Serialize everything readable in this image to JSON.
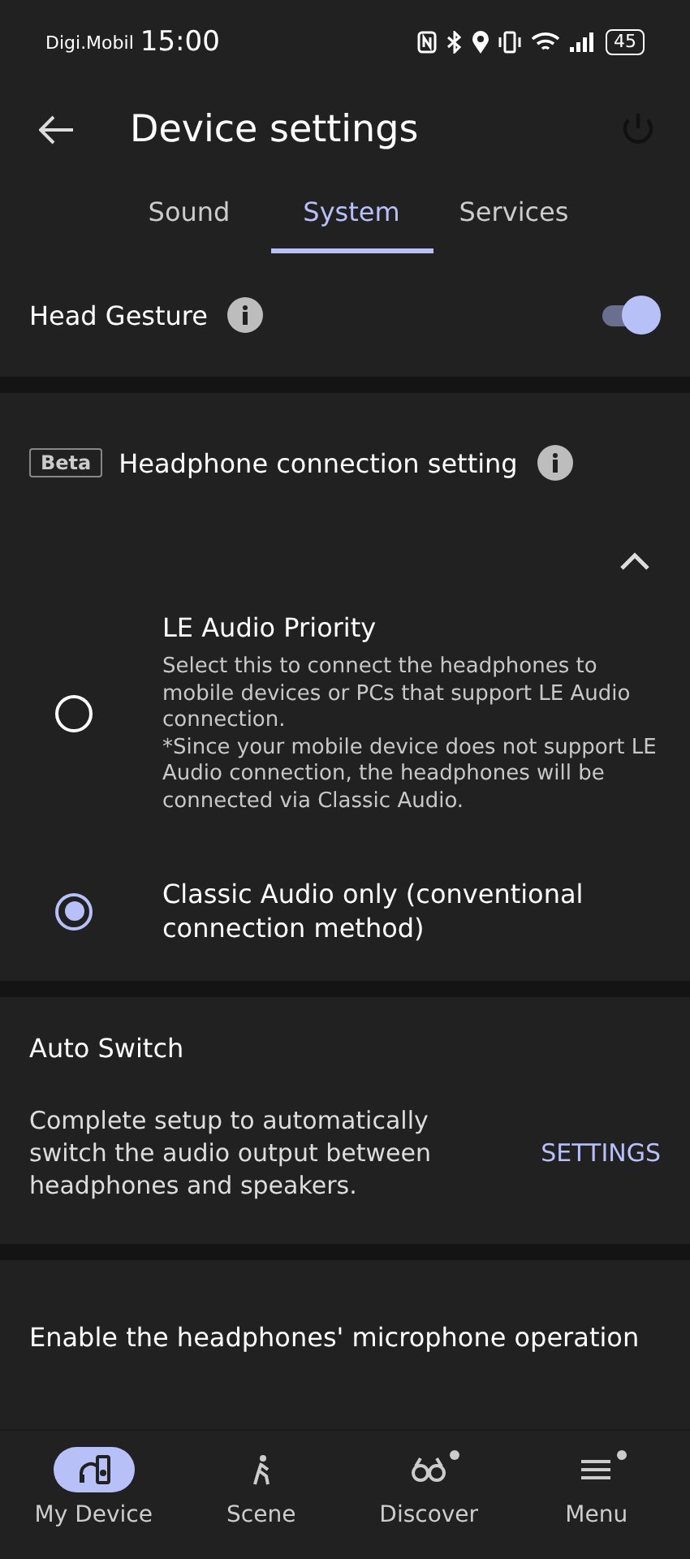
{
  "status_bar": {
    "carrier": "Digi.Mobil",
    "time": "15:00",
    "battery": "45"
  },
  "header": {
    "title": "Device settings"
  },
  "tabs": [
    {
      "label": "Sound",
      "selected": false
    },
    {
      "label": "System",
      "selected": true
    },
    {
      "label": "Services",
      "selected": false
    }
  ],
  "head_gesture": {
    "label": "Head Gesture",
    "on": true
  },
  "connection": {
    "badge": "Beta",
    "title": "Headphone connection setting",
    "expanded": true,
    "options": [
      {
        "title": "LE Audio Priority",
        "description": "Select this to connect the headphones to mobile devices or PCs that support LE Audio connection.\n*Since your mobile device does not support LE Audio connection, the headphones will be connected via Classic Audio.",
        "selected": false
      },
      {
        "title": "Classic Audio only (conventional connection method)",
        "selected": true
      }
    ]
  },
  "auto_switch": {
    "title": "Auto Switch",
    "description": "Complete setup to automatically switch the audio output between headphones and speakers.",
    "action": "SETTINGS"
  },
  "microphone": {
    "title": "Enable the headphones' microphone operation"
  },
  "nav": [
    {
      "kind": "device",
      "label": "My Device",
      "selected": true,
      "dot": false
    },
    {
      "kind": "scene",
      "label": "Scene",
      "selected": false,
      "dot": false
    },
    {
      "kind": "discover",
      "label": "Discover",
      "selected": false,
      "dot": true
    },
    {
      "kind": "menu",
      "label": "Menu",
      "selected": false,
      "dot": true
    }
  ]
}
